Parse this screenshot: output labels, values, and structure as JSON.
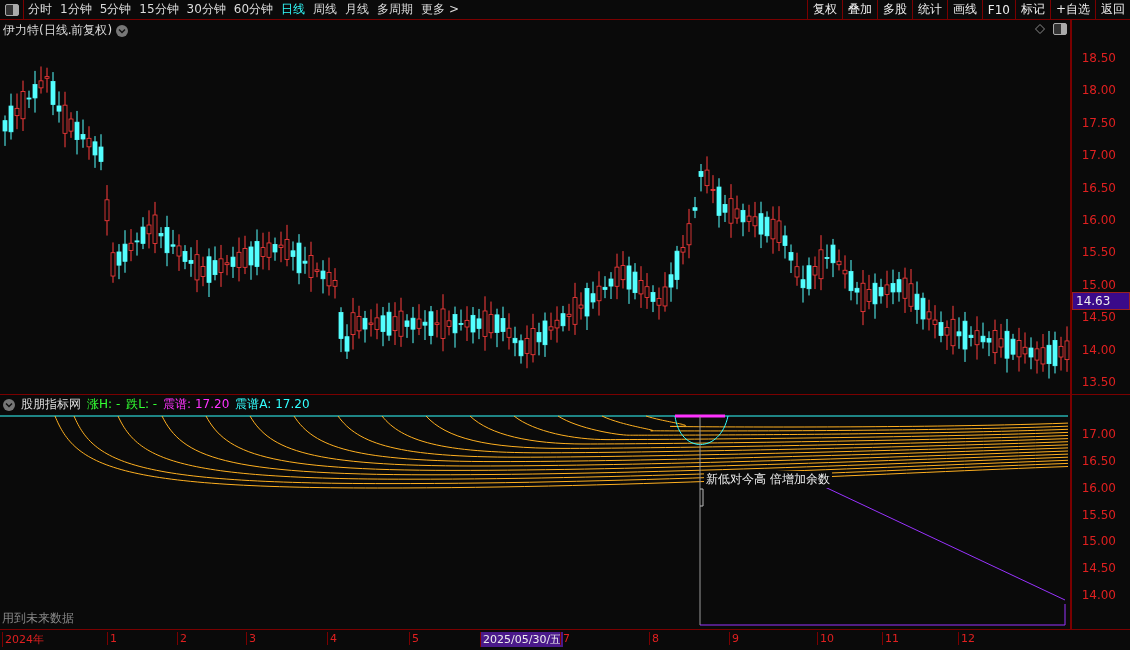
{
  "toolbar": {
    "periods": [
      {
        "label": "分时",
        "selected": false
      },
      {
        "label": "1分钟",
        "selected": false
      },
      {
        "label": "5分钟",
        "selected": false
      },
      {
        "label": "15分钟",
        "selected": false
      },
      {
        "label": "30分钟",
        "selected": false
      },
      {
        "label": "60分钟",
        "selected": false
      },
      {
        "label": "日线",
        "selected": true
      },
      {
        "label": "周线",
        "selected": false
      },
      {
        "label": "月线",
        "selected": false
      },
      {
        "label": "多周期",
        "selected": false
      },
      {
        "label": "更多 >",
        "selected": false
      }
    ],
    "buttons": [
      "复权",
      "叠加",
      "多股",
      "统计",
      "画线",
      "F10",
      "标记",
      "+自选",
      "返回"
    ]
  },
  "main_chart": {
    "title": "伊力特(日线.前复权)",
    "price_ticks": [
      "18.50",
      "18.00",
      "17.50",
      "17.00",
      "16.50",
      "16.00",
      "15.50",
      "15.00",
      "14.50",
      "14.00",
      "13.50"
    ],
    "last_price": "14.63"
  },
  "indicator": {
    "name": "股朋指标网",
    "values": [
      {
        "text": "涨H: -",
        "color": "#33ff33"
      },
      {
        "text": "跌L: -",
        "color": "#33ff33"
      },
      {
        "text": "震谱: 17.20",
        "color": "#ff33ff"
      },
      {
        "text": "震谱A: 17.20",
        "color": "#33ffff"
      }
    ],
    "ticks": [
      "17.00",
      "16.50",
      "16.00",
      "15.50",
      "15.00",
      "14.50",
      "14.00"
    ],
    "annotation": "新低对今高 倍增加余数",
    "note": "用到未来数据"
  },
  "date_axis": [
    {
      "label": "2024年",
      "selected": false
    },
    {
      "label": "1",
      "selected": false
    },
    {
      "label": "2",
      "selected": false
    },
    {
      "label": "3",
      "selected": false
    },
    {
      "label": "4",
      "selected": false
    },
    {
      "label": "5",
      "selected": false
    },
    {
      "label": "2025/05/30/五",
      "selected": true
    },
    {
      "label": "7",
      "selected": false
    },
    {
      "label": "8",
      "selected": false
    },
    {
      "label": "9",
      "selected": false
    },
    {
      "label": "10",
      "selected": false
    },
    {
      "label": "11",
      "selected": false
    },
    {
      "label": "12",
      "selected": false
    }
  ]
}
